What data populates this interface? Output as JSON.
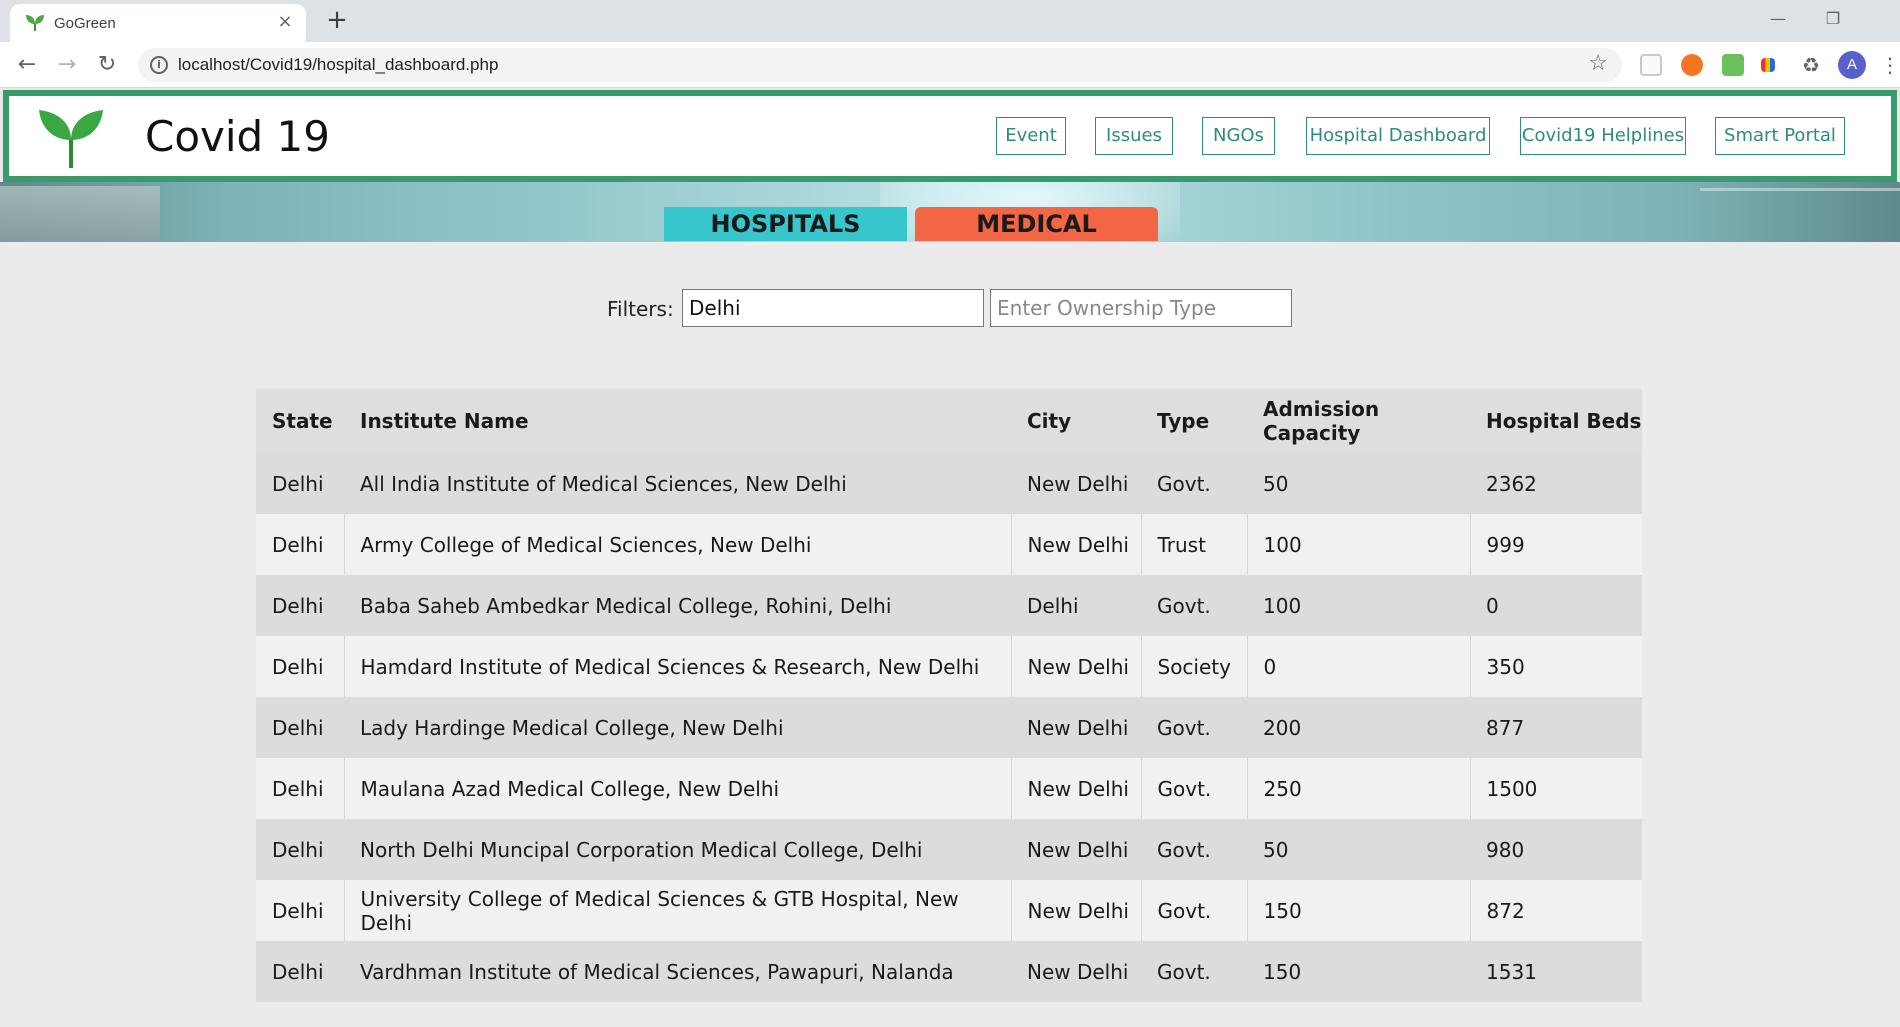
{
  "browser": {
    "tab_title": "GoGreen",
    "tab_close": "×",
    "new_tab": "+",
    "url": "localhost/Covid19/hospital_dashboard.php",
    "avatar_letter": "A"
  },
  "header": {
    "brand": "Covid 19",
    "nav": [
      "Event",
      "Issues",
      "NGOs",
      "Hospital Dashboard",
      "Covid19 Helplines",
      "Smart Portal"
    ]
  },
  "segments": {
    "hospitals": "HOSPITALS",
    "medical_colleges": "MEDICAL COLLEGES"
  },
  "filters": {
    "label": "Filters:",
    "state_value": "Delhi",
    "ownership_placeholder": "Enter Ownership Type"
  },
  "table": {
    "headers": [
      "State",
      "Institute Name",
      "City",
      "Type",
      "Admission Capacity",
      "Hospital Beds"
    ],
    "rows": [
      [
        "Delhi",
        "All India Institute of Medical Sciences, New Delhi",
        "New Delhi",
        "Govt.",
        "50",
        "2362"
      ],
      [
        "Delhi",
        "Army College of Medical Sciences, New Delhi",
        "New Delhi",
        "Trust",
        "100",
        "999"
      ],
      [
        "Delhi",
        "Baba Saheb Ambedkar Medical College, Rohini, Delhi",
        "Delhi",
        "Govt.",
        "100",
        "0"
      ],
      [
        "Delhi",
        "Hamdard Institute of Medical Sciences & Research, New Delhi",
        "New Delhi",
        "Society",
        "0",
        "350"
      ],
      [
        "Delhi",
        "Lady Hardinge Medical College, New Delhi",
        "New Delhi",
        "Govt.",
        "200",
        "877"
      ],
      [
        "Delhi",
        "Maulana Azad Medical College, New Delhi",
        "New Delhi",
        "Govt.",
        "250",
        "1500"
      ],
      [
        "Delhi",
        "North Delhi Muncipal Corporation Medical College, Delhi",
        "New Delhi",
        "Govt.",
        "50",
        "980"
      ],
      [
        "Delhi",
        "University College of Medical Sciences & GTB Hospital, New Delhi",
        "New Delhi",
        "Govt.",
        "150",
        "872"
      ],
      [
        "Delhi",
        "Vardhman Institute of Medical Sciences, Pawapuri, Nalanda",
        "New Delhi",
        "Govt.",
        "150",
        "1531"
      ]
    ]
  },
  "colors": {
    "header_border": "#3a9a6e",
    "nav_accent": "#2f8a83",
    "hospitals_tab": "#36c6cb",
    "colleges_tab": "#f26545"
  }
}
